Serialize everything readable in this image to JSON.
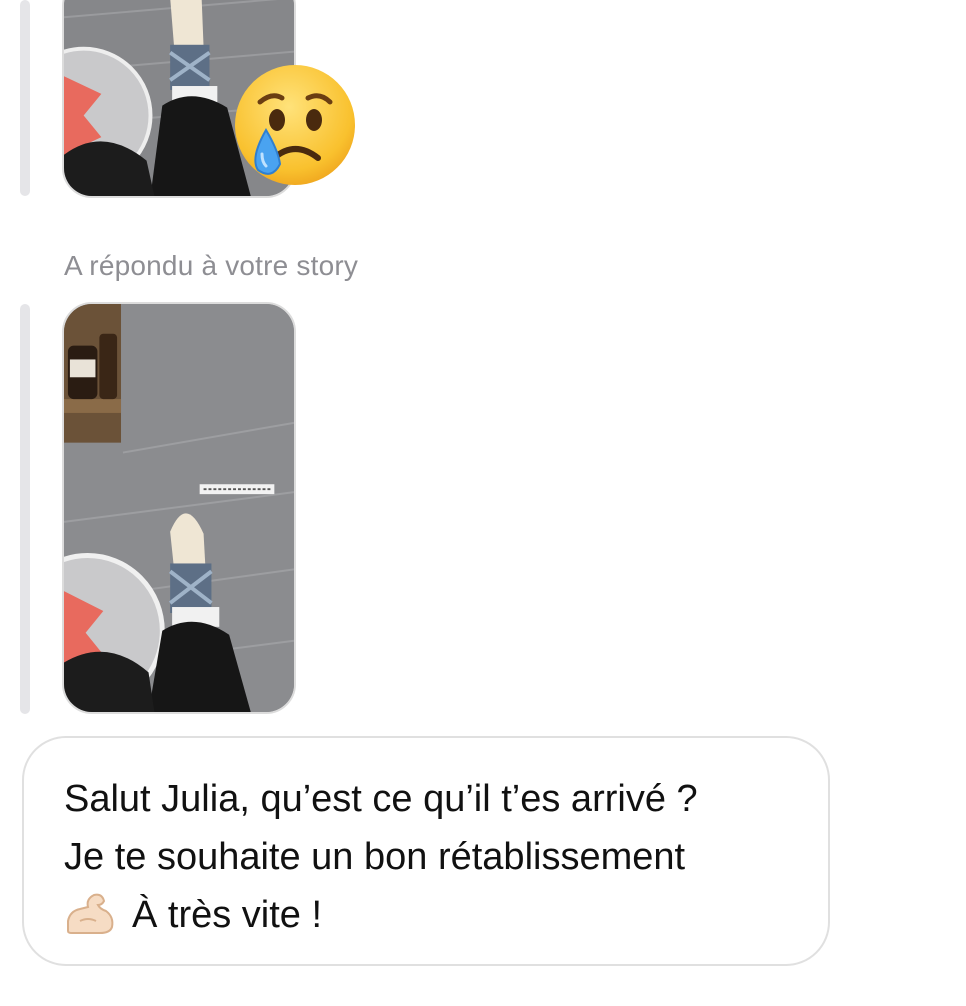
{
  "conversation": {
    "reply_label": "A répondu à votre story",
    "reaction": {
      "emoji_icon": "crying-face-icon"
    },
    "story_previews": [
      {
        "icon": "story-photo-injured-ankle"
      },
      {
        "icon": "story-photo-injured-ankle"
      }
    ],
    "message": {
      "line1": "Salut Julia, qu’est ce qu’il t’es arrivé ?",
      "line2": "Je te souhaite un bon rétablissement",
      "line3_icon": "flexed-biceps-icon",
      "line3_text": "À très vite !"
    }
  },
  "colors": {
    "reply_line": "#e5e5e8",
    "secondary_text": "#8e8e93",
    "bubble_border": "#e0e0e0"
  }
}
